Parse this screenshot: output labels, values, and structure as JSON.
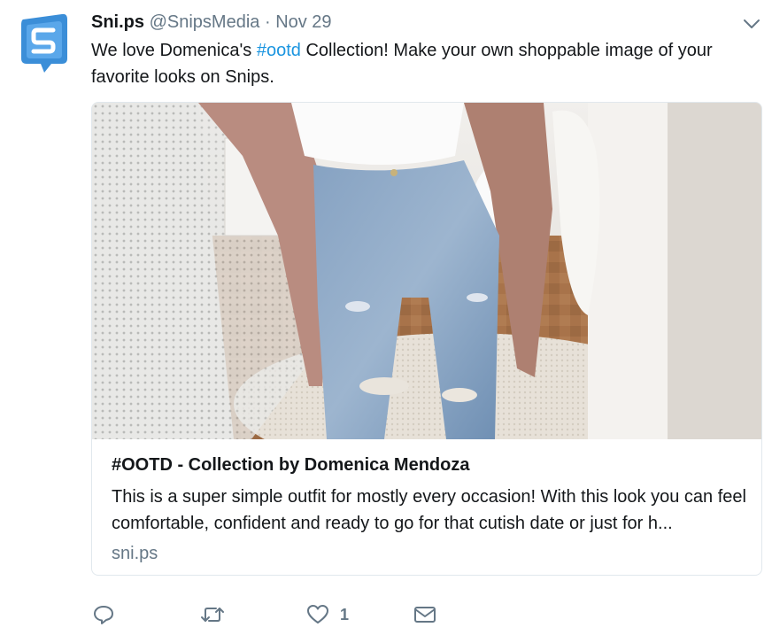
{
  "tweet": {
    "display_name": "Sni.ps",
    "handle": "@SnipsMedia",
    "separator": "·",
    "date": "Nov 29",
    "text_before": "We love Domenica's ",
    "hashtag": "#ootd",
    "text_after": " Collection! Make your own shoppable image of your favorite looks on Snips."
  },
  "card": {
    "title": "#OOTD - Collection by Domenica Mendoza",
    "description": "This is a super simple outfit for mostly every occasion! With this look you can feel comfortable, confident and ready to go for that cutish date or just for h...",
    "domain": "sni.ps"
  },
  "actions": {
    "like_count": "1"
  },
  "icons": {
    "avatar": "snips-logo-icon",
    "caret": "chevron-down-icon",
    "reply": "reply-icon",
    "retweet": "retweet-icon",
    "like": "heart-icon",
    "message": "envelope-icon"
  },
  "colors": {
    "link": "#1b95e0",
    "secondary_text": "#657786",
    "brand_blue": "#3b8ed8"
  }
}
